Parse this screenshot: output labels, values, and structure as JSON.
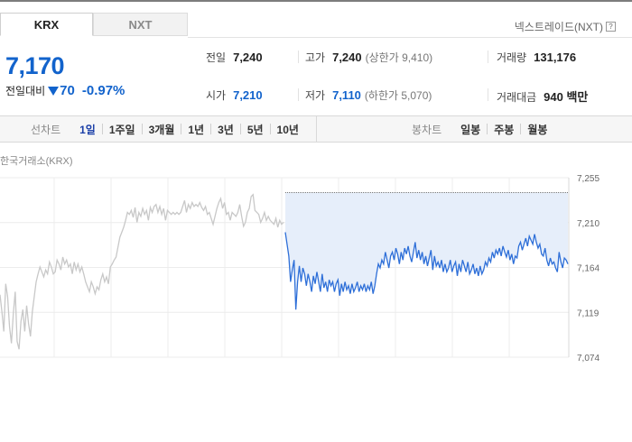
{
  "tabs": {
    "krx": "KRX",
    "nxt": "NXT"
  },
  "nxt_link": "넥스트레이드(NXT)",
  "help_glyph": "?",
  "price": "7,170",
  "change": {
    "label": "전일대비",
    "value": "70",
    "rate": "-0.97%",
    "direction": "down"
  },
  "stats": {
    "prev_close": {
      "label": "전일",
      "value": "7,240"
    },
    "high": {
      "label": "고가",
      "value": "7,240",
      "sub": "(상한가 9,410)"
    },
    "volume": {
      "label": "거래량",
      "value": "131,176"
    },
    "open": {
      "label": "시가",
      "value": "7,210"
    },
    "low": {
      "label": "저가",
      "value": "7,110",
      "sub": "(하한가 5,070)"
    },
    "turnover": {
      "label": "거래대금",
      "value": "940 백만"
    }
  },
  "period_bar": {
    "line_title": "선차트",
    "line_periods": [
      "1일",
      "1주일",
      "3개월",
      "1년",
      "3년",
      "5년",
      "10년"
    ],
    "selected": "1일",
    "candle_title": "봉차트",
    "candle_periods": [
      "일봉",
      "주봉",
      "월봉"
    ]
  },
  "source_label": "한국거래소(KRX)",
  "colors": {
    "up_blue": "#1263cc",
    "line_gray": "#c8c8c8",
    "line_blue": "#2e6fd8",
    "fill_blue": "#e6eefa"
  },
  "chart_data": {
    "type": "line",
    "y_ticks": [
      "7,255",
      "7,210",
      "7,164",
      "7,119",
      "7,074"
    ],
    "ylim": [
      7074,
      7255
    ],
    "reference_line": 7240,
    "series": [
      {
        "values": [
          7137,
          7120,
          7100,
          7148,
          7135,
          7105,
          7088,
          7118,
          7140,
          7090,
          7082,
          7110,
          7122,
          7100,
          7126,
          7108,
          7095,
          7120,
          7135,
          7150,
          7158,
          7165,
          7160,
          7155,
          7162,
          7158,
          7170,
          7165,
          7158,
          7160,
          7172,
          7168,
          7162,
          7175,
          7168,
          7172,
          7165,
          7168,
          7158,
          7170,
          7162,
          7168,
          7160,
          7165,
          7158,
          7150,
          7145,
          7140,
          7150,
          7145,
          7138,
          7145,
          7142,
          7152,
          7158,
          7150,
          7155,
          7148,
          7165,
          7168,
          7172,
          7175,
          7185,
          7195,
          7200,
          7205,
          7212,
          7220,
          7218,
          7222,
          7215,
          7225,
          7210,
          7220,
          7216,
          7224,
          7218,
          7222,
          7212,
          7225,
          7220,
          7226,
          7228,
          7220,
          7226,
          7218,
          7224,
          7212,
          7222,
          7220,
          7218,
          7220,
          7218,
          7220,
          7218,
          7220,
          7226,
          7232,
          7220,
          7228,
          7224,
          7230,
          7226,
          7228,
          7226,
          7230,
          7225,
          7222,
          7226,
          7218,
          7220,
          7214,
          7208,
          7216,
          7224,
          7230,
          7234,
          7224,
          7230,
          7218,
          7220,
          7212,
          7220,
          7218,
          7216,
          7220,
          7228,
          7216,
          7206,
          7210,
          7220,
          7224,
          7236,
          7238,
          7222,
          7220,
          7218,
          7210,
          7214,
          7220,
          7212,
          7216,
          7212,
          7210,
          7208,
          7214,
          7205,
          7212,
          7208,
          7210
        ]
      },
      {
        "values": [
          7200,
          7188,
          7176,
          7150,
          7162,
          7172,
          7122,
          7150,
          7166,
          7150,
          7164,
          7158,
          7146,
          7158,
          7150,
          7140,
          7156,
          7148,
          7160,
          7150,
          7140,
          7158,
          7144,
          7150,
          7140,
          7152,
          7146,
          7150,
          7140,
          7148,
          7152,
          7136,
          7148,
          7140,
          7150,
          7142,
          7146,
          7138,
          7148,
          7140,
          7144,
          7150,
          7140,
          7146,
          7142,
          7148,
          7140,
          7146,
          7142,
          7150,
          7138,
          7146,
          7158,
          7168,
          7164,
          7172,
          7168,
          7180,
          7172,
          7164,
          7176,
          7180,
          7172,
          7184,
          7178,
          7168,
          7180,
          7172,
          7184,
          7178,
          7186,
          7176,
          7170,
          7180,
          7190,
          7174,
          7182,
          7172,
          7180,
          7168,
          7176,
          7166,
          7174,
          7182,
          7162,
          7176,
          7166,
          7170,
          7164,
          7172,
          7160,
          7168,
          7160,
          7164,
          7172,
          7160,
          7166,
          7170,
          7156,
          7168,
          7160,
          7172,
          7166,
          7160,
          7170,
          7158,
          7162,
          7168,
          7158,
          7164,
          7156,
          7166,
          7158,
          7162,
          7170,
          7166,
          7174,
          7170,
          7180,
          7174,
          7182,
          7178,
          7184,
          7176,
          7186,
          7180,
          7175,
          7182,
          7172,
          7178,
          7168,
          7176,
          7174,
          7186,
          7190,
          7182,
          7188,
          7194,
          7186,
          7196,
          7192,
          7188,
          7198,
          7190,
          7184,
          7188,
          7178,
          7176,
          7184,
          7172,
          7166,
          7174,
          7168,
          7170,
          7164,
          7160,
          7180,
          7170,
          7164,
          7174,
          7172,
          7168
        ]
      }
    ]
  }
}
